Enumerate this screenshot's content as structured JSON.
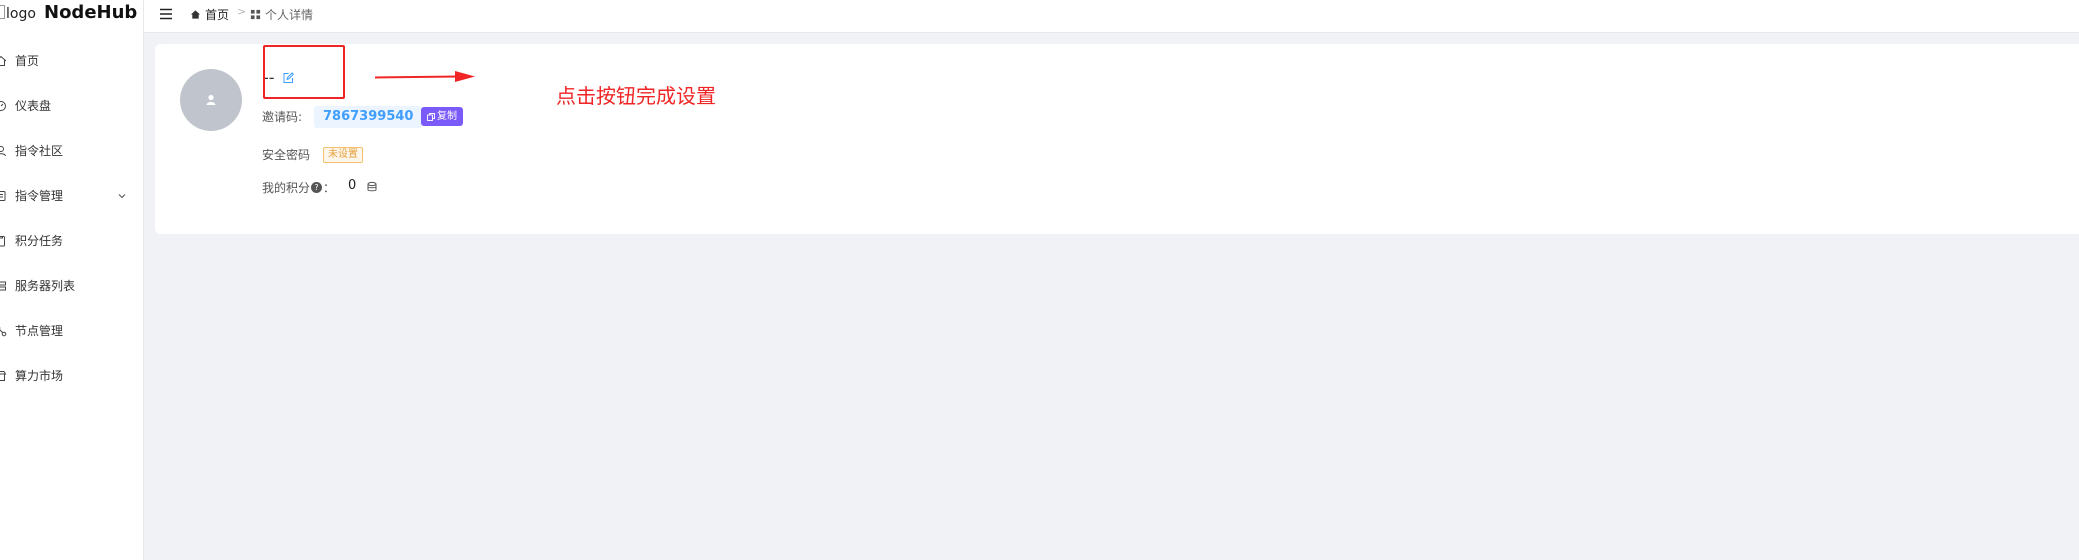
{
  "logo": {
    "alt": "logo",
    "title": "NodeHub"
  },
  "sidebar": {
    "items": [
      {
        "label": "首页",
        "icon": "home-icon"
      },
      {
        "label": "仪表盘",
        "icon": "dashboard-icon"
      },
      {
        "label": "指令社区",
        "icon": "community-icon"
      },
      {
        "label": "指令管理",
        "icon": "command-manage-icon",
        "expandable": true
      },
      {
        "label": "积分任务",
        "icon": "task-icon"
      },
      {
        "label": "服务器列表",
        "icon": "server-icon"
      },
      {
        "label": "节点管理",
        "icon": "node-icon"
      },
      {
        "label": "算力市场",
        "icon": "market-icon"
      }
    ]
  },
  "header": {
    "breadcrumb_home": "首页",
    "breadcrumb_separator": ">",
    "breadcrumb_current": "个人详情"
  },
  "profile": {
    "nickname": "--",
    "invite_label": "邀请码:",
    "invite_code": "7867399540",
    "copy_label": "复制",
    "security_label": "安全密码",
    "security_status": "未设置",
    "points_label": "我的积分",
    "points_help": "?",
    "points_colon": "：",
    "points_value": "0"
  },
  "annotation": {
    "hint": "点击按钮完成设置",
    "color": "#f02525"
  },
  "colors": {
    "accent": "#409eff",
    "copy_button": "#7a5af8",
    "warning": "#e6a23c"
  }
}
